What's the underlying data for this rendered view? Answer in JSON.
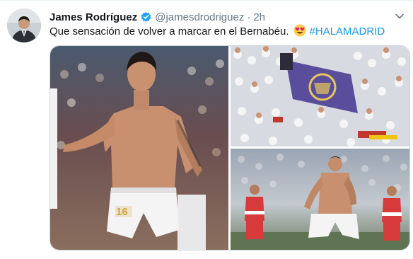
{
  "tweet": {
    "author_name": "James Rodríguez",
    "handle": "@jamesdrodriguez",
    "separator": "·",
    "time": "2h",
    "text": "Que sensación de volver a marcar en el Bernabéu.",
    "hashtag": "#HALAMADRID"
  },
  "media": {
    "jersey_number": "16"
  },
  "icons": {
    "verified": "verified-badge-icon",
    "emoji": "heart-eyes-emoji",
    "caret": "chevron-down-icon"
  },
  "colors": {
    "verified_blue": "#1da1f2",
    "hashtag_blue": "#1b95e0",
    "secondary_text": "#657786",
    "border": "#ccd6dd"
  }
}
